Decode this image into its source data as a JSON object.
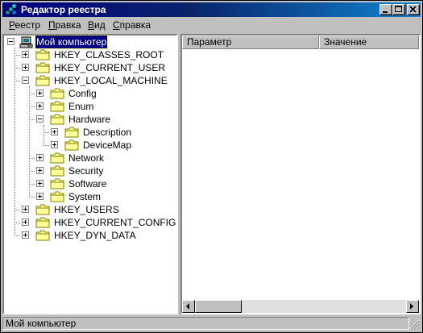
{
  "window": {
    "title": "Редактор реестра",
    "icon": "registry-editor-icon",
    "controls": [
      "minimize-icon",
      "maximize-icon",
      "close-icon"
    ]
  },
  "menu": {
    "items": [
      "Реестр",
      "Правка",
      "Вид",
      "Справка"
    ]
  },
  "tree": {
    "root": "Мой компьютер",
    "hkey_classes_root": "HKEY_CLASSES_ROOT",
    "hkey_current_user": "HKEY_CURRENT_USER",
    "hkey_local_machine": "HKEY_LOCAL_MACHINE",
    "config": "Config",
    "enum": "Enum",
    "hardware": "Hardware",
    "description": "Description",
    "devicemap": "DeviceMap",
    "network": "Network",
    "security": "Security",
    "software": "Software",
    "system": "System",
    "hkey_users": "HKEY_USERS",
    "hkey_current_config": "HKEY_CURRENT_CONFIG",
    "hkey_dyn_data": "HKEY_DYN_DATA"
  },
  "list": {
    "columns": [
      "Параметр",
      "Значение"
    ]
  },
  "status": {
    "text": "Мой компьютер"
  },
  "colors": {
    "titlebar": "#000080",
    "selection": "#000080",
    "folder": "#ffff99",
    "face": "#c0c0c0"
  }
}
